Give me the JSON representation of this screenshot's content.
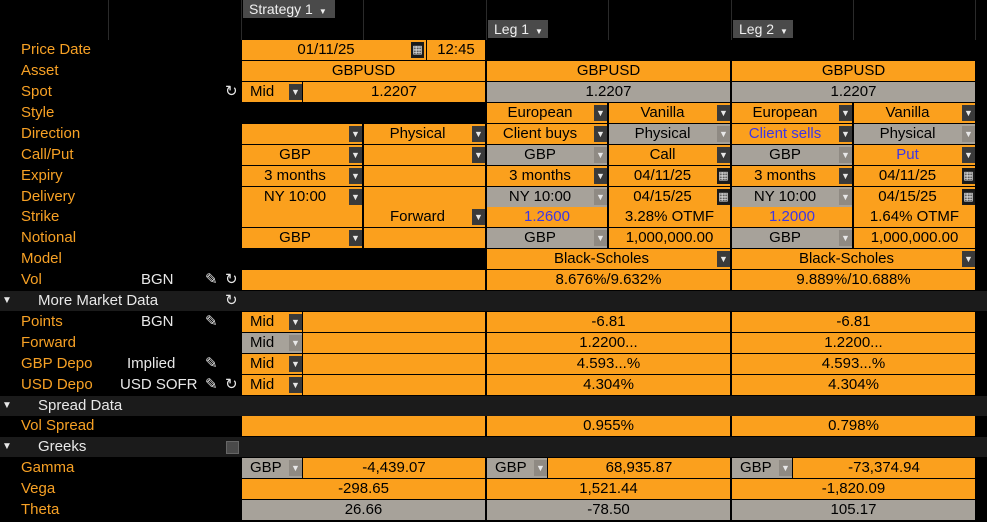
{
  "tabs": {
    "strategy": "Strategy 1",
    "leg1": "Leg 1",
    "leg2": "Leg 2"
  },
  "price_date": {
    "label": "Price Date",
    "date": "01/11/25",
    "time": "12:45"
  },
  "asset": {
    "label": "Asset",
    "col": "GBPUSD",
    "leg1": "GBPUSD",
    "leg2": "GBPUSD"
  },
  "spot": {
    "label": "Spot",
    "side": "Mid",
    "col": "1.2207",
    "leg1": "1.2207",
    "leg2": "1.2207"
  },
  "style": {
    "label": "Style",
    "leg1_style": "European",
    "leg1_type": "Vanilla",
    "leg2_style": "European",
    "leg2_type": "Vanilla"
  },
  "direction": {
    "label": "Direction",
    "col_settle": "Physical",
    "leg1_dir": "Client buys",
    "leg1_settle": "Physical",
    "leg2_dir": "Client sells",
    "leg2_settle": "Physical"
  },
  "callput": {
    "label": "Call/Put",
    "col_ccy": "GBP",
    "leg1_ccy": "GBP",
    "leg1_cp": "Call",
    "leg2_ccy": "GBP",
    "leg2_cp": "Put"
  },
  "expiry": {
    "label": "Expiry",
    "col": "3 months",
    "leg1_tenor": "3 months",
    "leg1_date": "04/11/25",
    "leg2_tenor": "3 months",
    "leg2_date": "04/11/25"
  },
  "delivery": {
    "label": "Delivery",
    "col": "NY 10:00",
    "leg1_cut": "NY 10:00",
    "leg1_date": "04/15/25",
    "leg2_cut": "NY 10:00",
    "leg2_date": "04/15/25"
  },
  "strike": {
    "label": "Strike",
    "col": "Forward",
    "leg1_strike": "1.2600",
    "leg1_otm": "3.28% OTMF",
    "leg2_strike": "1.2000",
    "leg2_otm": "1.64% OTMF"
  },
  "notional": {
    "label": "Notional",
    "col_ccy": "GBP",
    "leg1_ccy": "GBP",
    "leg1_amt": "1,000,000.00",
    "leg2_ccy": "GBP",
    "leg2_amt": "1,000,000.00"
  },
  "model": {
    "label": "Model",
    "leg1": "Black-Scholes",
    "leg2": "Black-Scholes"
  },
  "vol": {
    "label": "Vol",
    "source": "BGN",
    "leg1": "8.676%/9.632%",
    "leg2": "9.889%/10.688%"
  },
  "more_market": {
    "label": "More Market Data"
  },
  "points": {
    "label": "Points",
    "source": "BGN",
    "side": "Mid",
    "leg1": "-6.81",
    "leg2": "-6.81"
  },
  "forward": {
    "label": "Forward",
    "side": "Mid",
    "leg1": "1.2200...",
    "leg2": "1.2200..."
  },
  "gbp_depo": {
    "label": "GBP Depo",
    "source": "Implied",
    "side": "Mid",
    "leg1": "4.593...%",
    "leg2": "4.593...%"
  },
  "usd_depo": {
    "label": "USD Depo",
    "source": "USD SOFR",
    "side": "Mid",
    "leg1": "4.304%",
    "leg2": "4.304%"
  },
  "spread_data": {
    "label": "Spread Data"
  },
  "vol_spread": {
    "label": "Vol Spread",
    "leg1": "0.955%",
    "leg2": "0.798%"
  },
  "greeks": {
    "label": "Greeks"
  },
  "gamma": {
    "label": "Gamma",
    "col_ccy": "GBP",
    "col": "-4,439.07",
    "leg1_ccy": "GBP",
    "leg1": "68,935.87",
    "leg2_ccy": "GBP",
    "leg2": "-73,374.94"
  },
  "vega": {
    "label": "Vega",
    "col": "-298.65",
    "leg1": "1,521.44",
    "leg2": "-1,820.09"
  },
  "theta": {
    "label": "Theta",
    "col": "26.66",
    "leg1": "-78.50",
    "leg2": "105.17"
  },
  "colors": {
    "orange": "#fba01d",
    "gray": "#a7a29a",
    "label_orange": "#f7a125",
    "blue_text": "#3c36e8",
    "background": "#000000"
  }
}
